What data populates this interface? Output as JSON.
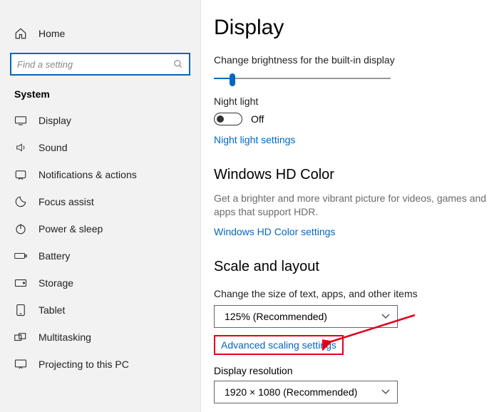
{
  "sidebar": {
    "home": "Home",
    "search_placeholder": "Find a setting",
    "system_header": "System",
    "items": [
      {
        "label": "Display"
      },
      {
        "label": "Sound"
      },
      {
        "label": "Notifications & actions"
      },
      {
        "label": "Focus assist"
      },
      {
        "label": "Power & sleep"
      },
      {
        "label": "Battery"
      },
      {
        "label": "Storage"
      },
      {
        "label": "Tablet"
      },
      {
        "label": "Multitasking"
      },
      {
        "label": "Projecting to this PC"
      }
    ]
  },
  "main": {
    "title": "Display",
    "brightness_label": "Change brightness for the built-in display",
    "night_light_label": "Night light",
    "night_light_state": "Off",
    "night_light_link": "Night light settings",
    "hd": {
      "heading": "Windows HD Color",
      "desc": "Get a brighter and more vibrant picture for videos, games and apps that support HDR.",
      "link": "Windows HD Color settings"
    },
    "scale": {
      "heading": "Scale and layout",
      "size_label": "Change the size of text, apps, and other items",
      "size_value": "125% (Recommended)",
      "advanced_link": "Advanced scaling settings",
      "res_label": "Display resolution",
      "res_value": "1920 × 1080 (Recommended)"
    }
  }
}
